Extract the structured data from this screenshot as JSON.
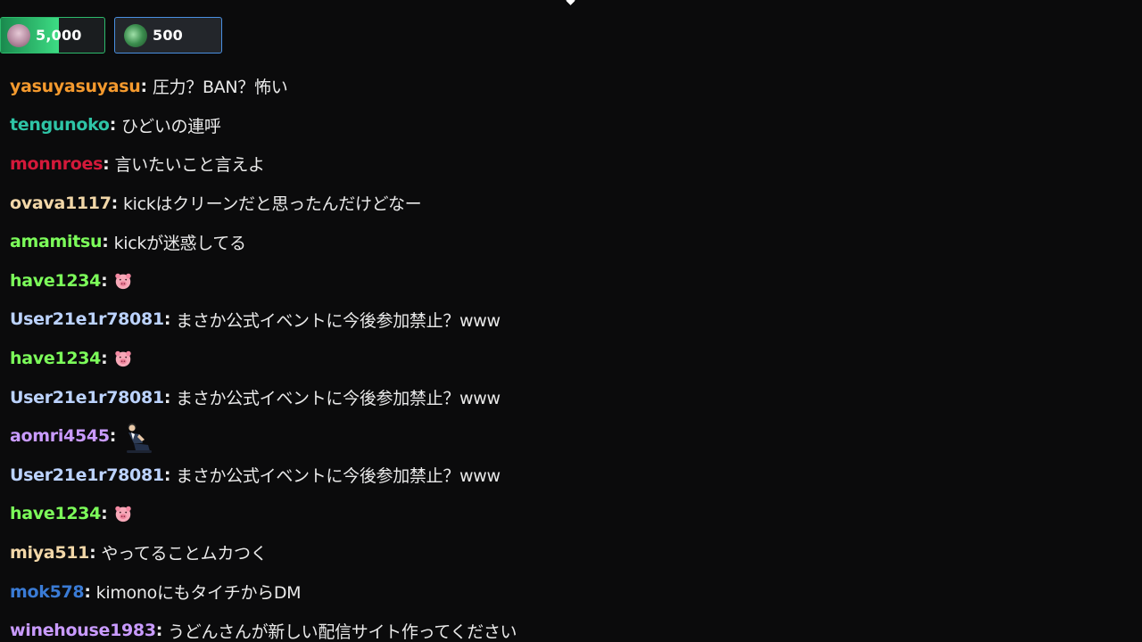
{
  "pinned": [
    {
      "amount": "5,000",
      "avatar": "user-avatar",
      "color": "#3ddc84",
      "progress": 0.56
    },
    {
      "amount": "500",
      "avatar": "user-avatar",
      "color": "#4a90e2"
    }
  ],
  "messages": [
    {
      "user": "yasuyasuyasu",
      "color": "#f59a2e",
      "text": "圧力？BAN？怖い"
    },
    {
      "user": "tengunoko",
      "color": "#2ec4a6",
      "text": "ひどいの連呼"
    },
    {
      "user": "monnroes",
      "color": "#d4193a",
      "text": "言いたいこと言えよ"
    },
    {
      "user": "ovava1117",
      "color": "#f2d7a8",
      "text": "kickはクリーンだと思ったんだけどなー"
    },
    {
      "user": "amamitsu",
      "color": "#7cfc5a",
      "text": "kickが迷惑してる"
    },
    {
      "user": "have1234",
      "color": "#7cfc5a",
      "text": "",
      "emote": "pig-emote"
    },
    {
      "user": "User21e1r78081",
      "color": "#bcd3ff",
      "text": "まさか公式イベントに今後参加禁止？www"
    },
    {
      "user": "have1234",
      "color": "#7cfc5a",
      "text": "",
      "emote": "pig-emote"
    },
    {
      "user": "User21e1r78081",
      "color": "#bcd3ff",
      "text": "まさか公式イベントに今後参加禁止？www"
    },
    {
      "user": "aomri4545",
      "color": "#c99bff",
      "text": "",
      "emote": "kneeling-person-emote"
    },
    {
      "user": "User21e1r78081",
      "color": "#bcd3ff",
      "text": "まさか公式イベントに今後参加禁止？www"
    },
    {
      "user": "have1234",
      "color": "#7cfc5a",
      "text": "",
      "emote": "pig-emote"
    },
    {
      "user": "miya511",
      "color": "#f2d7a8",
      "text": "やってることムカつく"
    },
    {
      "user": "mok578",
      "color": "#3a7bd5",
      "text": "kimonoにもタイチからDM"
    },
    {
      "user": "winehouse1983",
      "color": "#c99bff",
      "text": "うどんさんが新しい配信サイト作ってください"
    }
  ],
  "colors": {
    "background": "#0b0b0c",
    "message_text": "#eaeaea"
  }
}
